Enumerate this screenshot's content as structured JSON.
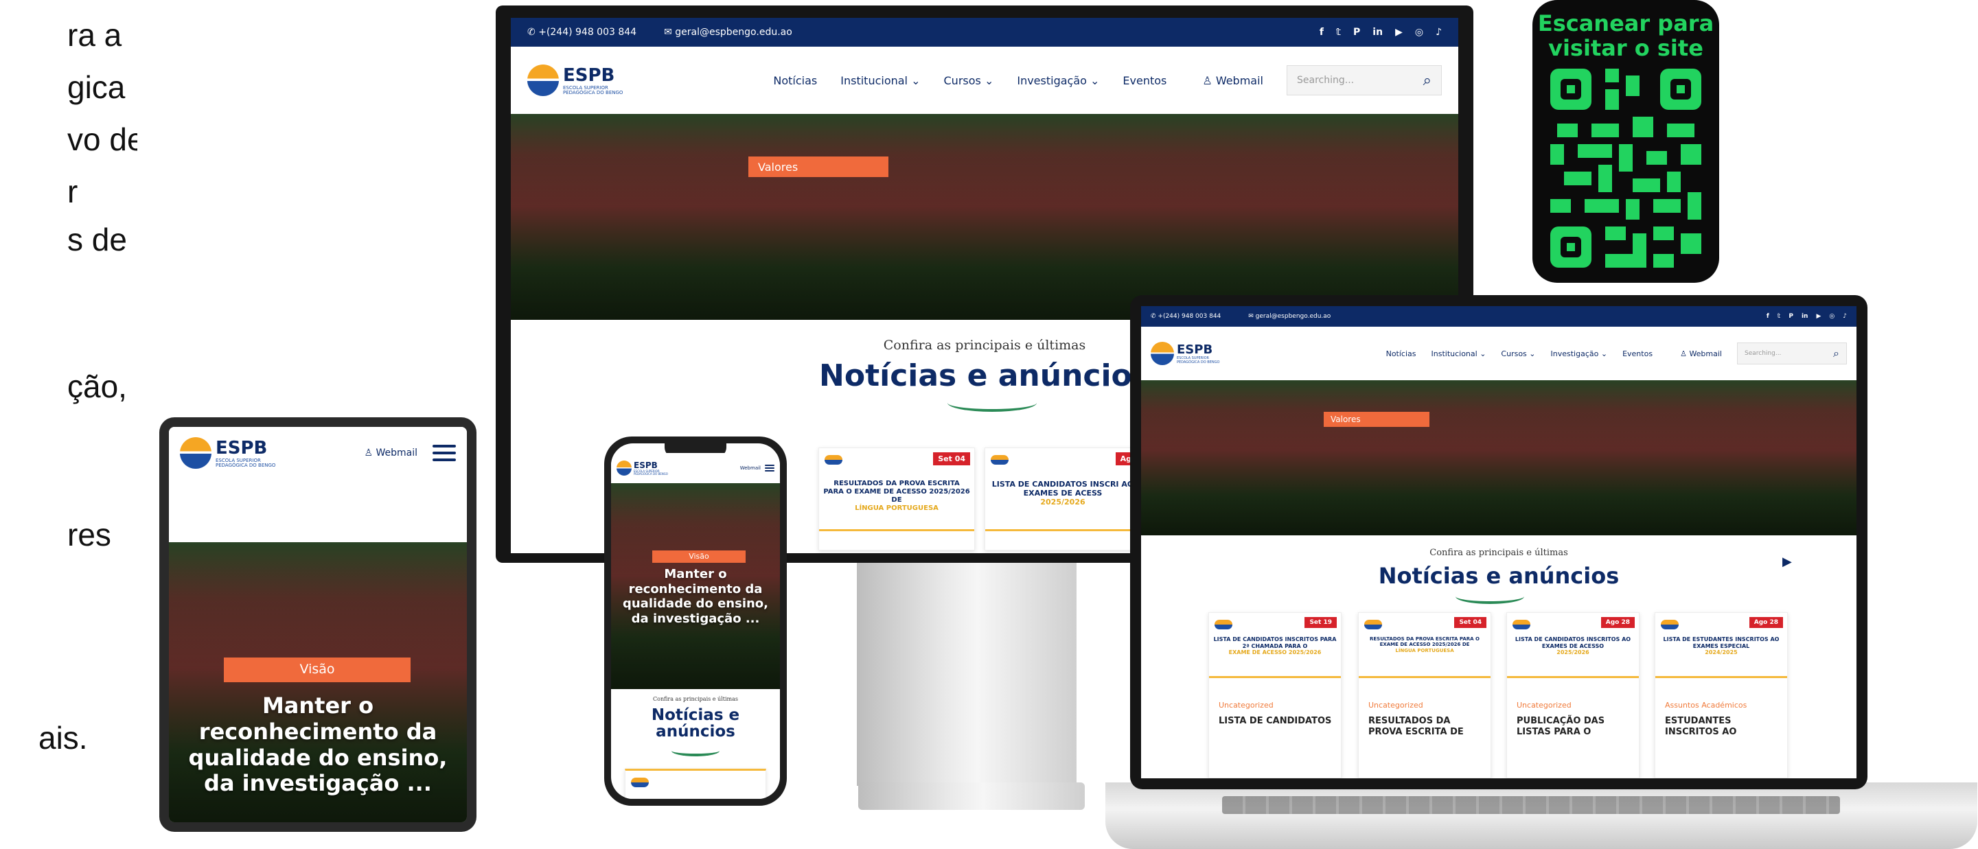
{
  "colors": {
    "navy": "#0d2a66",
    "accent": "#f06a3c",
    "badge_red": "#d6222a",
    "qr_green": "#22d35f"
  },
  "left_text": [
    "ra a",
    "gica",
    "vo de",
    "r",
    "s de",
    "ção,",
    "res",
    "ais."
  ],
  "site": {
    "phone": "+(244) 948 003 844",
    "email": "geral@espbengo.edu.ao",
    "social_icons": [
      "facebook-icon",
      "twitter-icon",
      "pinterest-icon",
      "linkedin-icon",
      "youtube-icon",
      "instagram-icon",
      "tiktok-icon"
    ],
    "logo_abbr": "ESPB",
    "logo_line1": "ESCOLA SUPERIOR",
    "logo_line2": "PEDAGÓGICA DO BENGO",
    "nav": {
      "noticias": "Notícias",
      "institucional": "Institucional ⌄",
      "cursos": "Cursos ⌄",
      "investigacao": "Investigação ⌄",
      "eventos": "Eventos"
    },
    "webmail": "Webmail",
    "search_placeholder": "Searching...",
    "hero_tag_valores": "Valores",
    "hero_tag_visao": "Visão",
    "hero_caption": "Manter o reconhecimento da qualidade do ensino, da investigação ...",
    "section_sub": "Confira as principais e últimas",
    "section_title": "Notícias e anúncios",
    "section_title_line1": "Notícias e",
    "section_title_line2": "anúncios"
  },
  "monitor_cards": [
    {
      "badge": "Set 04",
      "title": "RESULTADOS DA PROVA ESCRITA PARA O EXAME DE ACESSO 2025/2026 DE",
      "highlight": "LÍNGUA PORTUGUESA"
    },
    {
      "badge": "Ag",
      "title": "LISTA DE CANDIDATOS INSCRI AO EXAMES DE ACESS",
      "highlight": "2025/2026"
    }
  ],
  "laptop_cards": [
    {
      "badge": "Set 19",
      "title": "LISTA DE CANDIDATOS INSCRITOS PARA 2ª CHAMADA PARA O",
      "highlight": "EXAME DE ACESSO 2025/2026",
      "category": "Uncategorized",
      "headline": "LISTA DE CANDIDATOS"
    },
    {
      "badge": "Set 04",
      "title": "RESULTADOS DA PROVA ESCRITA PARA O EXAME DE ACESSO 2025/2026 DE",
      "highlight": "LÍNGUA PORTUGUESA",
      "category": "Uncategorized",
      "headline": "RESULTADOS DA PROVA ESCRITA DE"
    },
    {
      "badge": "Ago 28",
      "title": "LISTA DE CANDIDATOS INSCRITOS AO EXAMES DE ACESSO",
      "highlight": "2025/2026",
      "category": "Uncategorized",
      "headline": "PUBLICAÇÃO DAS LISTAS PARA O"
    },
    {
      "badge": "Ago 28",
      "title": "LISTA DE ESTUDANTES INSCRITOS AO EXAMES ESPECIAL",
      "highlight": "2024/2025",
      "category": "Assuntos Académicos",
      "headline": "ESTUDANTES INSCRITOS AO"
    }
  ],
  "qr": {
    "line1": "Escanear para",
    "line2": "visitar o site"
  }
}
